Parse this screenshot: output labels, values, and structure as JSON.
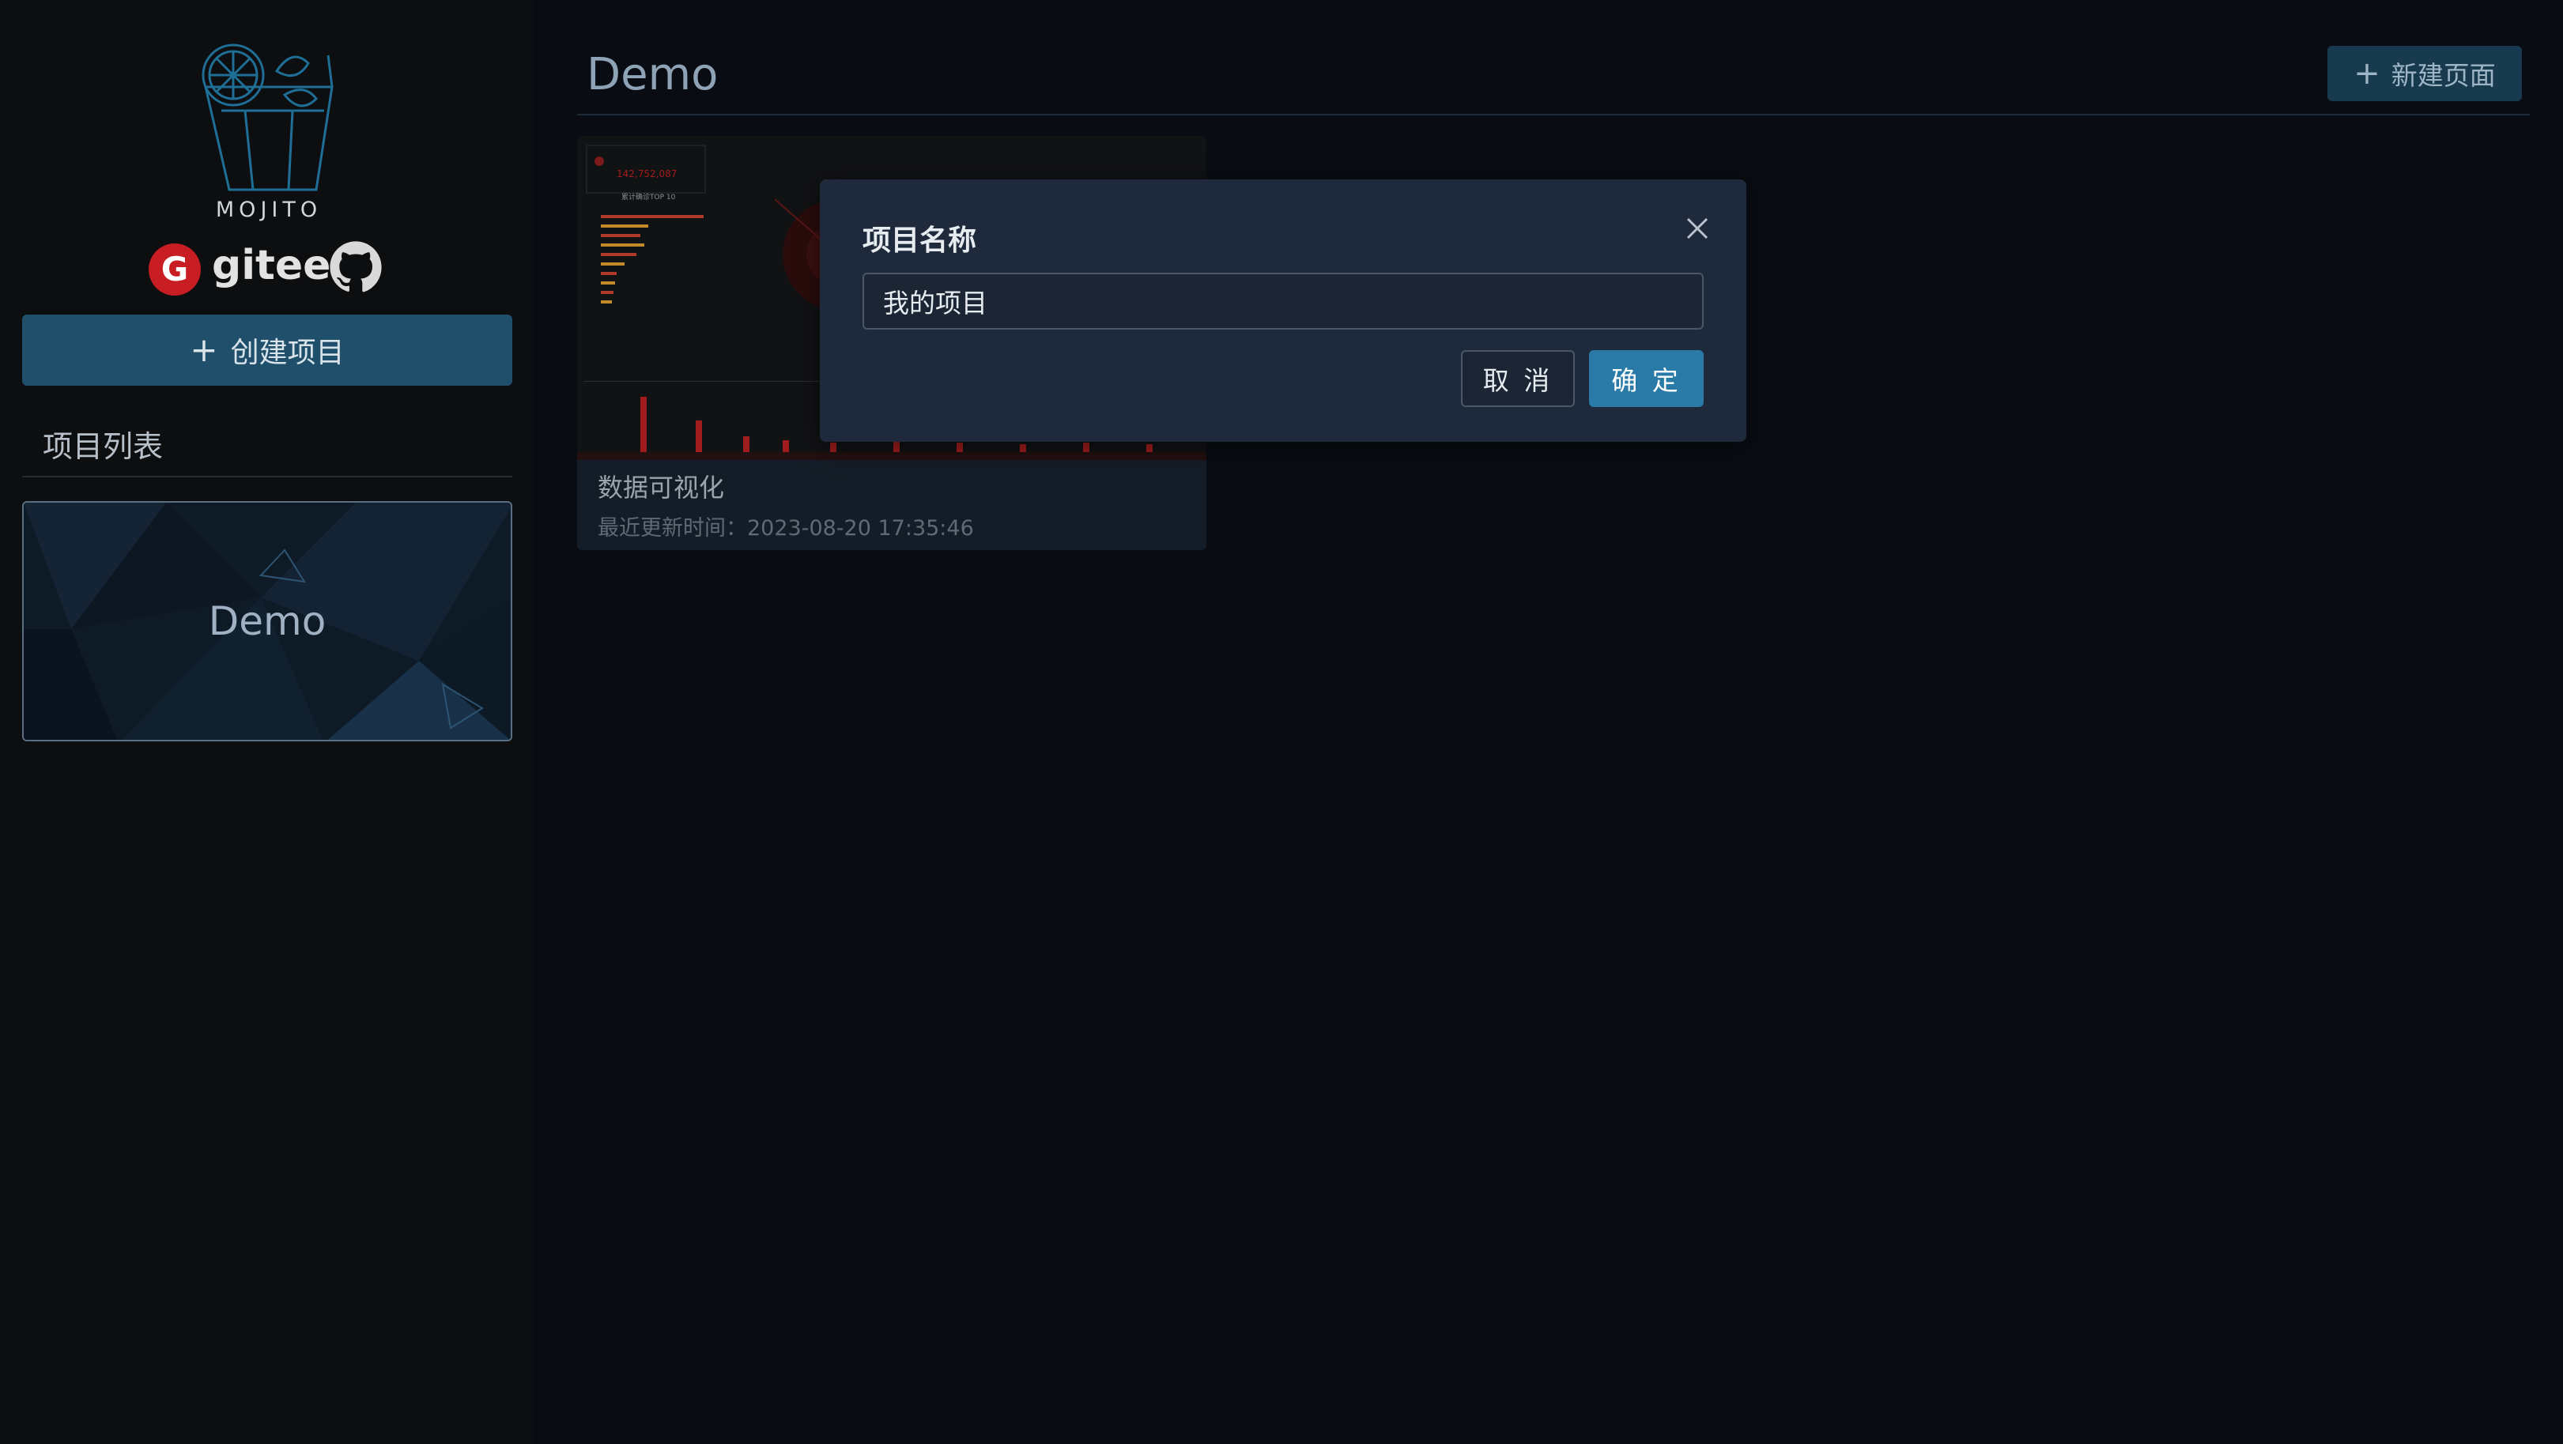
{
  "sidebar": {
    "logo_text": "MOJITO",
    "gitee_label": "gitee",
    "create_project_label": "创建项目",
    "project_list_title": "项目列表",
    "projects": [
      {
        "name": "Demo"
      }
    ]
  },
  "main": {
    "page_title": "Demo",
    "new_page_label": "新建页面",
    "pages": [
      {
        "title": "数据可视化",
        "updated": "最近更新时间：2023-08-20 17:35:46",
        "thumbnail_stat": "142,752,087",
        "thumbnail_top_label": "累计确诊TOP 10"
      }
    ]
  },
  "modal": {
    "title": "项目名称",
    "input_value": "我的项目",
    "cancel_label": "取 消",
    "ok_label": "确 定"
  },
  "colors": {
    "accent": "#2a7aa8",
    "sidebar_bg": "#0d0e10",
    "main_bg": "#090c12",
    "modal_bg": "#1e2a3b",
    "gitee_red": "#c71d23"
  },
  "icons": {
    "create_project": "plus-icon",
    "new_page": "plus-icon",
    "modal_close": "close-icon",
    "github": "github-icon",
    "gitee": "gitee-icon"
  }
}
